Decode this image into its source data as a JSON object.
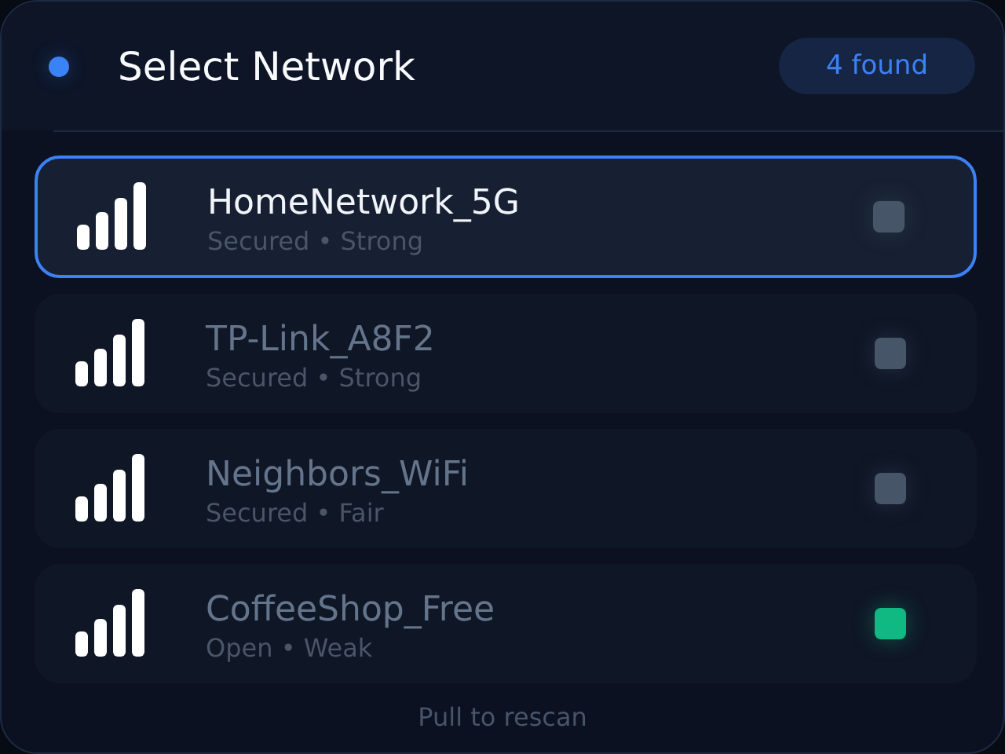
{
  "header": {
    "title": "Select Network",
    "count_badge": "4 found"
  },
  "networks": [
    {
      "name": "HomeNetwork_5G",
      "details": "Secured • Strong",
      "selected": true,
      "color": "#475569"
    },
    {
      "name": "TP-Link_A8F2",
      "details": "Secured • Strong",
      "selected": false,
      "color": "#475569"
    },
    {
      "name": "Neighbors_WiFi",
      "details": "Secured • Fair",
      "selected": false,
      "color": "#475569"
    },
    {
      "name": "CoffeeShop_Free",
      "details": "Open • Weak",
      "selected": false,
      "color": "#10b981"
    }
  ],
  "footer": "Pull to rescan"
}
